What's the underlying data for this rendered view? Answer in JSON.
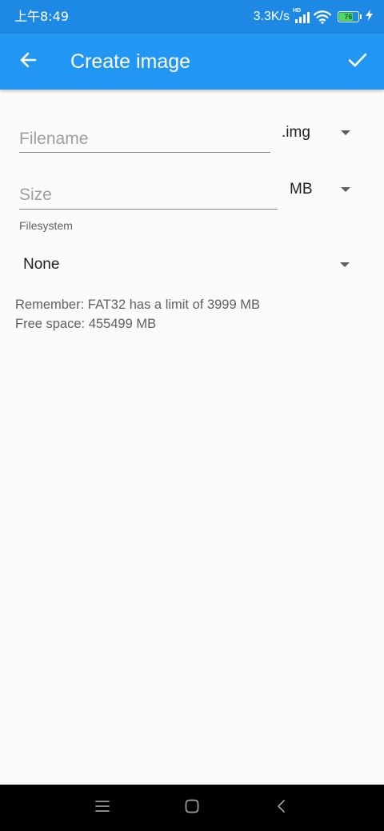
{
  "status_bar": {
    "time": "上午8:49",
    "net_speed": "3.3K/s",
    "hd_label": "HD",
    "battery_level": 76,
    "battery_label": "76",
    "battery_color": "#4cd964"
  },
  "app_bar": {
    "title": "Create image",
    "back_icon": "arrow-left-icon",
    "confirm_icon": "check-icon",
    "background": "#2196f3"
  },
  "form": {
    "filename": {
      "placeholder": "Filename",
      "value": ""
    },
    "extension": {
      "selected": ".img"
    },
    "size": {
      "placeholder": "Size",
      "value": ""
    },
    "size_unit": {
      "selected": "MB"
    },
    "filesystem": {
      "label": "Filesystem",
      "selected": "None"
    },
    "info": {
      "fat32_note": "Remember: FAT32 has a limit of 3999 MB",
      "free_space": "Free space: 455499 MB"
    }
  },
  "nav_bar": {
    "menu_icon": "menu-icon",
    "home_icon": "home-icon",
    "back_icon": "back-chevron-icon"
  }
}
